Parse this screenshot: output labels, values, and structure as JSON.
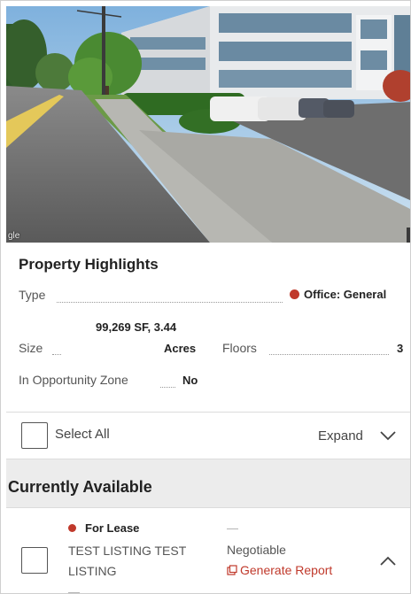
{
  "photo": {
    "credit": "gle"
  },
  "highlights": {
    "title": "Property Highlights",
    "type_label": "Type",
    "type_value": "Office: General",
    "size_label": "Size",
    "size_value_line1": "99,269 SF, 3.44",
    "size_value_line2": "Acres",
    "floors_label": "Floors",
    "floors_value": "3",
    "opportunity_label": "In Opportunity Zone",
    "opportunity_value": "No"
  },
  "controls": {
    "select_all_label": "Select All",
    "expand_label": "Expand"
  },
  "available": {
    "title": "Currently Available",
    "listings": [
      {
        "type": "For Lease",
        "name": "TEST LISTING TEST LISTING",
        "dash_top": "—",
        "dash_bottom": "—",
        "price": "Negotiable",
        "report_label": "Generate Report"
      }
    ]
  },
  "colors": {
    "accent_red": "#c0392b",
    "band_gray": "#ececec"
  }
}
